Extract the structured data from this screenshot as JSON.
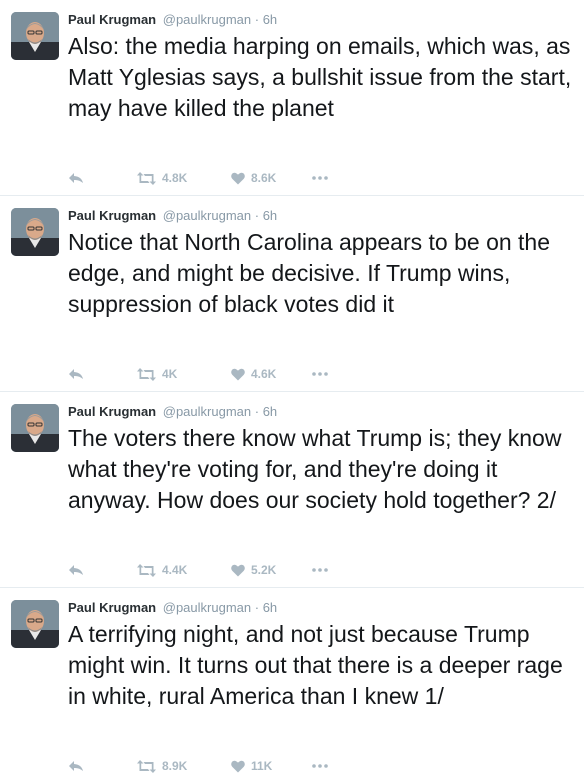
{
  "colors": {
    "name": "#292f33",
    "meta": "#8899a6",
    "action": "#aab8c2",
    "divider": "#e6ecf0"
  },
  "icons": [
    "reply-icon",
    "retweet-icon",
    "like-icon",
    "more-icon"
  ],
  "tweets": [
    {
      "author": "Paul Krugman",
      "handle": "@paulkrugman",
      "separator": "·",
      "time": "6h",
      "text": "Also: the media harping on emails, which was, as Matt Yglesias says, a bullshit issue from the start, may have killed the planet",
      "retweets": "4.8K",
      "likes": "8.6K"
    },
    {
      "author": "Paul Krugman",
      "handle": "@paulkrugman",
      "separator": "·",
      "time": "6h",
      "text": "Notice that North Carolina appears to be on the edge, and might be decisive. If Trump wins, suppression of black votes did it",
      "retweets": "4K",
      "likes": "4.6K"
    },
    {
      "author": "Paul Krugman",
      "handle": "@paulkrugman",
      "separator": "·",
      "time": "6h",
      "text": "The voters there know what Trump is; they know what they're voting for, and they're doing it anyway. How does our society hold together? 2/",
      "retweets": "4.4K",
      "likes": "5.2K"
    },
    {
      "author": "Paul Krugman",
      "handle": "@paulkrugman",
      "separator": "·",
      "time": "6h",
      "text": "A terrifying night, and not just because Trump might win. It turns out that there is a deeper rage in white, rural America than I knew 1/",
      "retweets": "8.9K",
      "likes": "11K"
    }
  ]
}
